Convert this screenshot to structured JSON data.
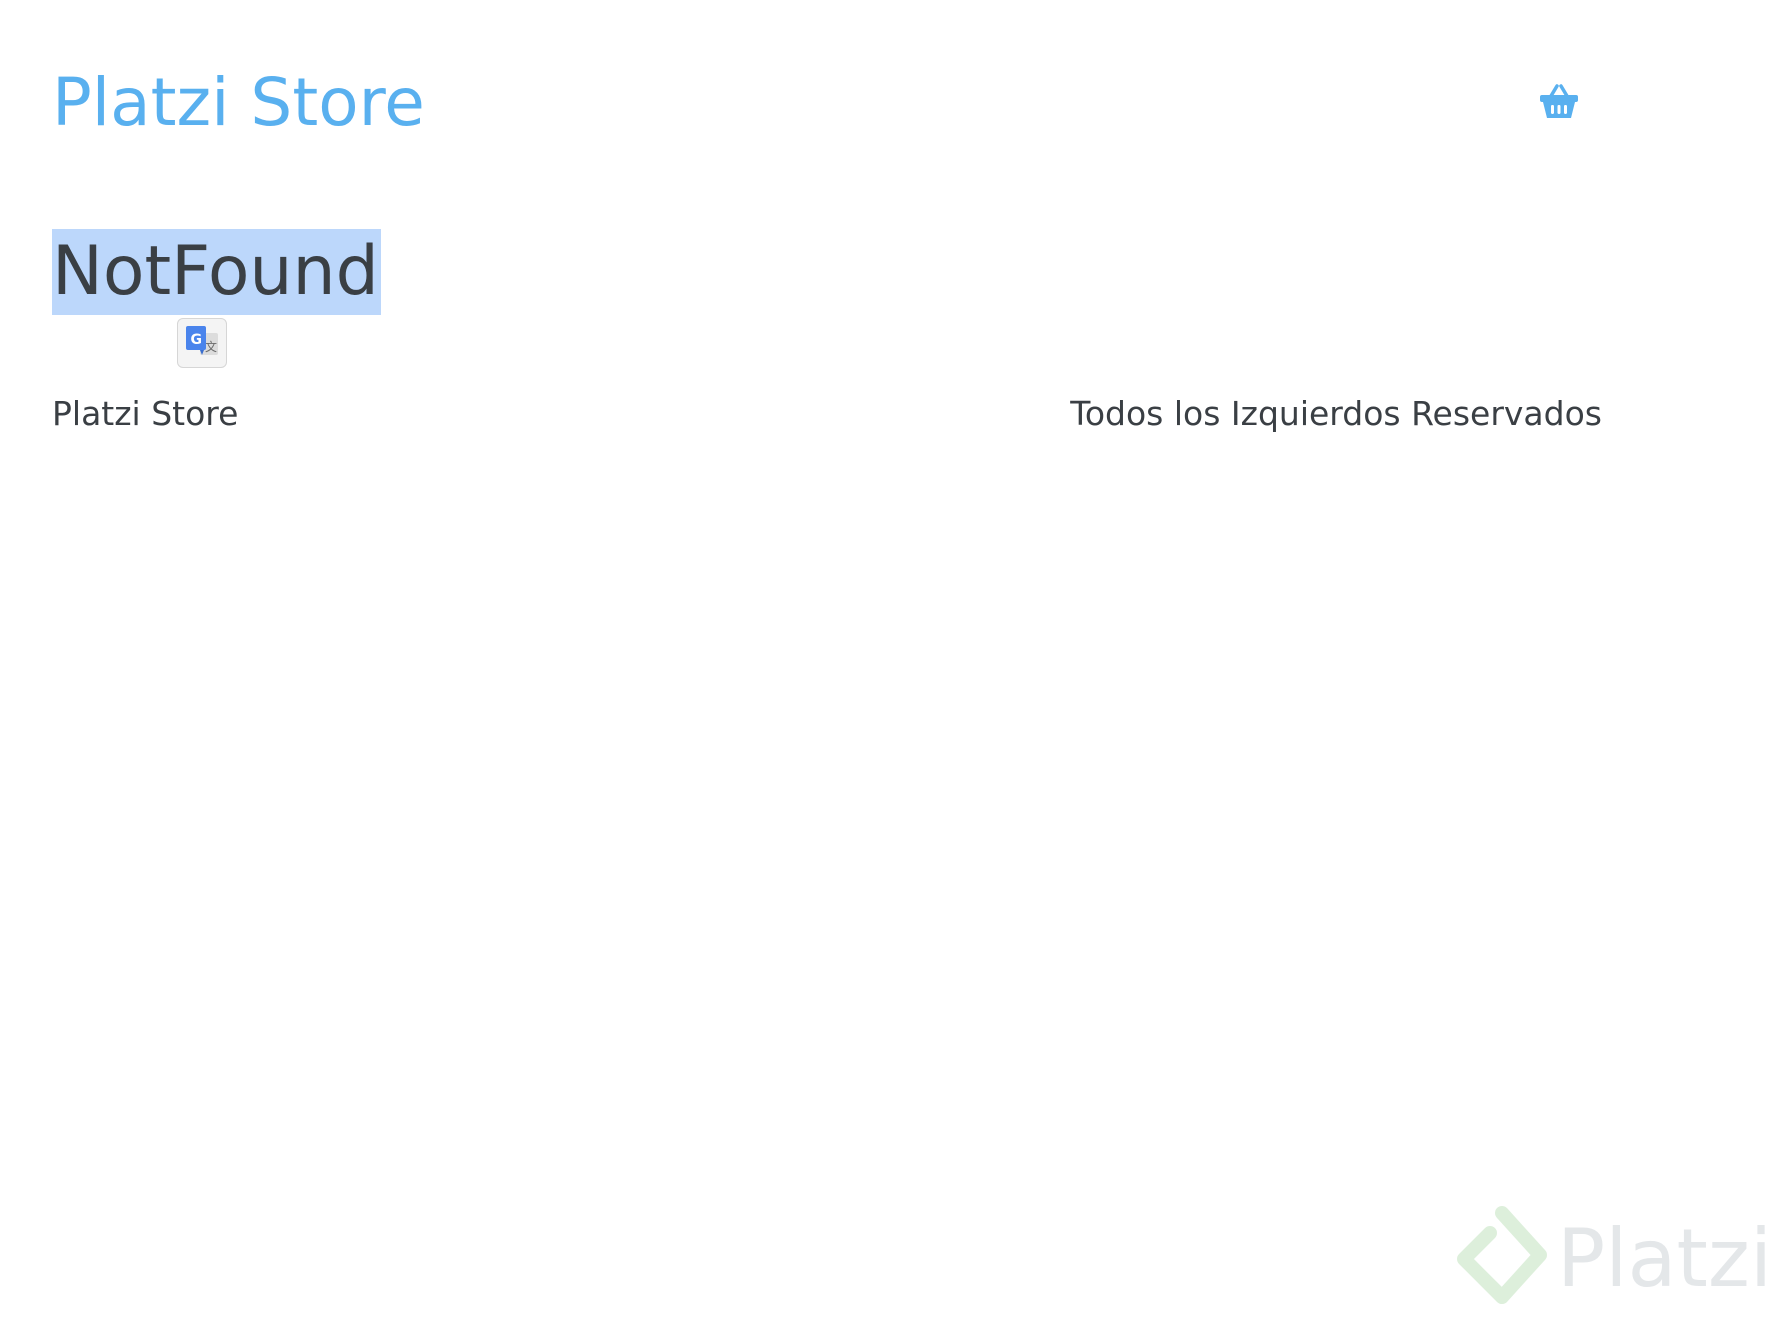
{
  "header": {
    "brand": "Platzi Store",
    "cart_icon": "basket-icon"
  },
  "main": {
    "title": "NotFound",
    "translate_icon": "google-translate-icon"
  },
  "footer": {
    "brand": "Platzi Store",
    "rights": "Todos los Izquierdos Reservados"
  },
  "watermark": {
    "text": "Platzi",
    "logo_icon": "platzi-logo-icon"
  },
  "colors": {
    "brand": "#59b0ef",
    "text": "#3a3f44",
    "selection": "#bcd7fb",
    "background": "#ffffff"
  }
}
